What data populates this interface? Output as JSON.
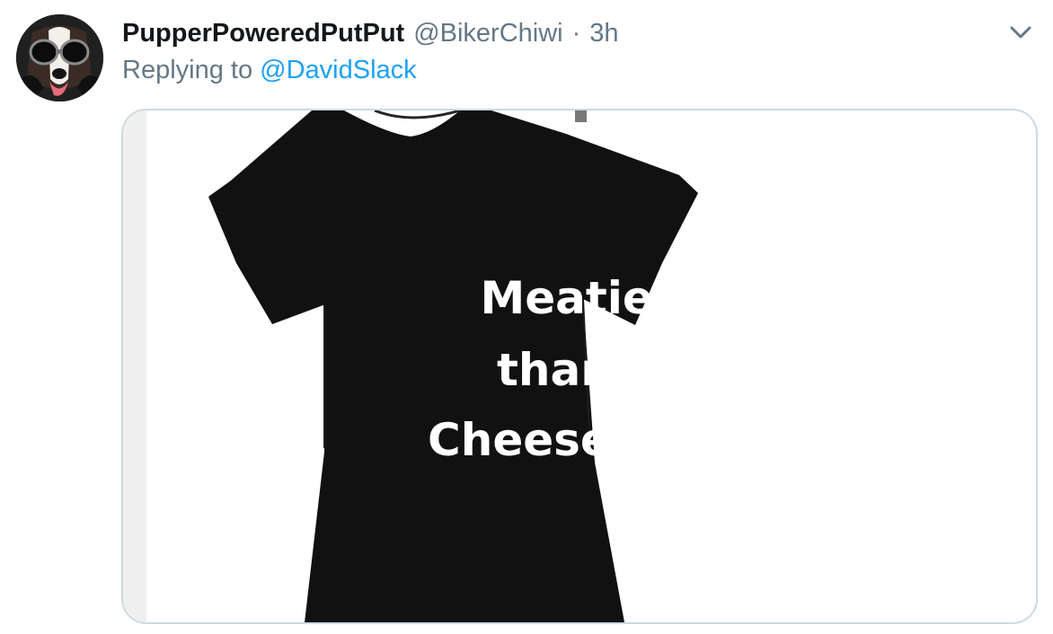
{
  "tweet": {
    "display_name": "PupperPoweredPutPut",
    "handle": "@BikerChiwi",
    "separator": "·",
    "time": "3h",
    "replying_prefix": "Replying to",
    "replying_to": "@DavidSlack"
  },
  "media": {
    "shirt_lines": [
      "Meatier",
      "than a",
      "Cheese Puff"
    ]
  },
  "icons": {
    "avatar": "dog-with-goggles-avatar",
    "menu": "chevron-down-icon"
  },
  "colors": {
    "name": "#14171a",
    "secondary": "#657786",
    "link": "#1da1f2",
    "shirt": "#111111"
  }
}
